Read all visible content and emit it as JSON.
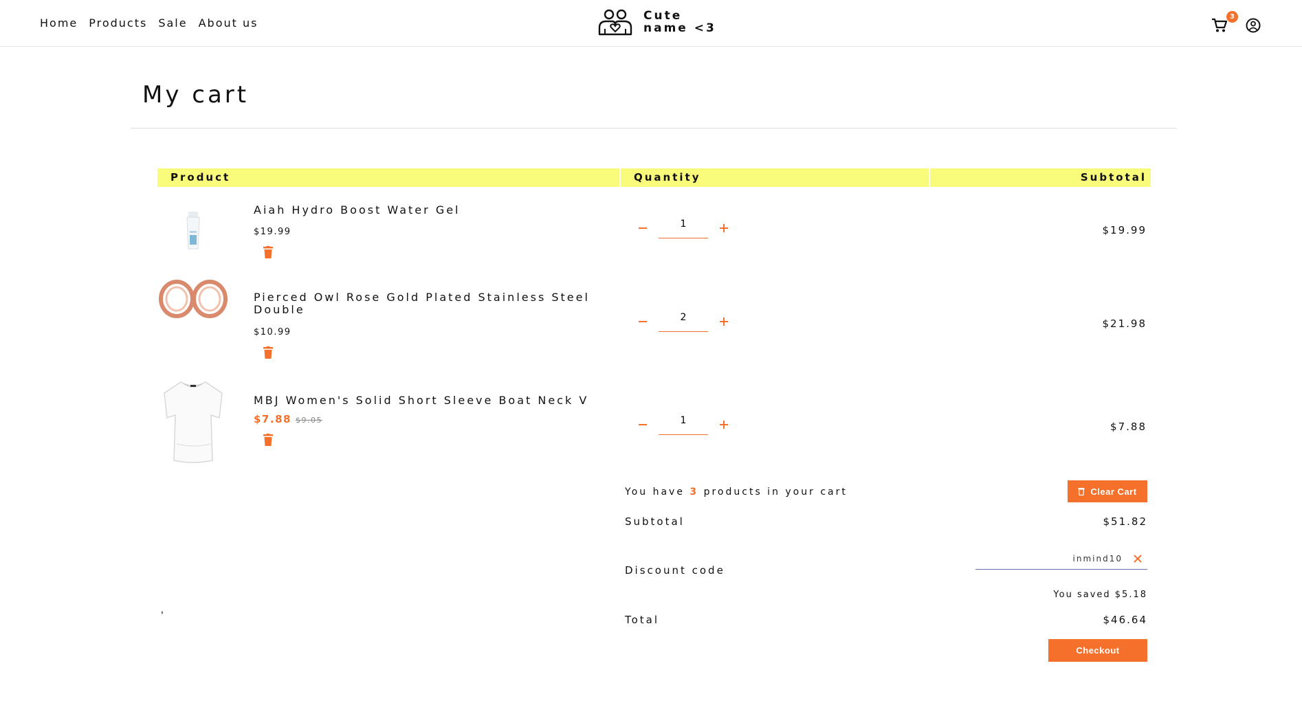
{
  "nav": {
    "items": [
      "Home",
      "Products",
      "Sale",
      "About us"
    ]
  },
  "brand": {
    "line1": "Cute",
    "line2": "name <3",
    "icon": "couple-icon"
  },
  "header": {
    "cart_count": "3",
    "cart_icon": "cart-icon",
    "account_icon": "user-circle-icon"
  },
  "page": {
    "title": "My cart"
  },
  "table": {
    "headers": [
      "Product",
      "Quantity",
      "Subtotal"
    ]
  },
  "items": [
    {
      "name": "Aiah Hydro Boost Water Gel",
      "price": "$19.99",
      "quantity": "1",
      "subtotal": "$19.99",
      "image": "gel-tube-image"
    },
    {
      "name": "Pierced Owl Rose Gold Plated Stainless Steel Double",
      "price": "$10.99",
      "quantity": "2",
      "subtotal": "$21.98",
      "image": "rose-gold-rings-image"
    },
    {
      "name": "MBJ Women's Solid Short Sleeve Boat Neck V",
      "sale_price": "$7.88",
      "original_price": "$9.05",
      "quantity": "1",
      "subtotal": "$7.88",
      "image": "white-tshirt-image"
    }
  ],
  "summary": {
    "count_prefix": "You have",
    "count": "3",
    "count_suffix": "products in your cart",
    "clear_label": "Clear Cart",
    "subtotal_label": "Subtotal",
    "subtotal_value": "$51.82",
    "discount_label": "Discount code",
    "discount_value": "inmind10",
    "saved_text": "You saved $5.18",
    "total_label": "Total",
    "total_value": "$46.64",
    "checkout_label": "Checkout"
  },
  "stray_mark": "'",
  "colors": {
    "accent": "#f5702a",
    "header_band": "#f9fb7b",
    "discount_underline": "#6b6fa8"
  }
}
